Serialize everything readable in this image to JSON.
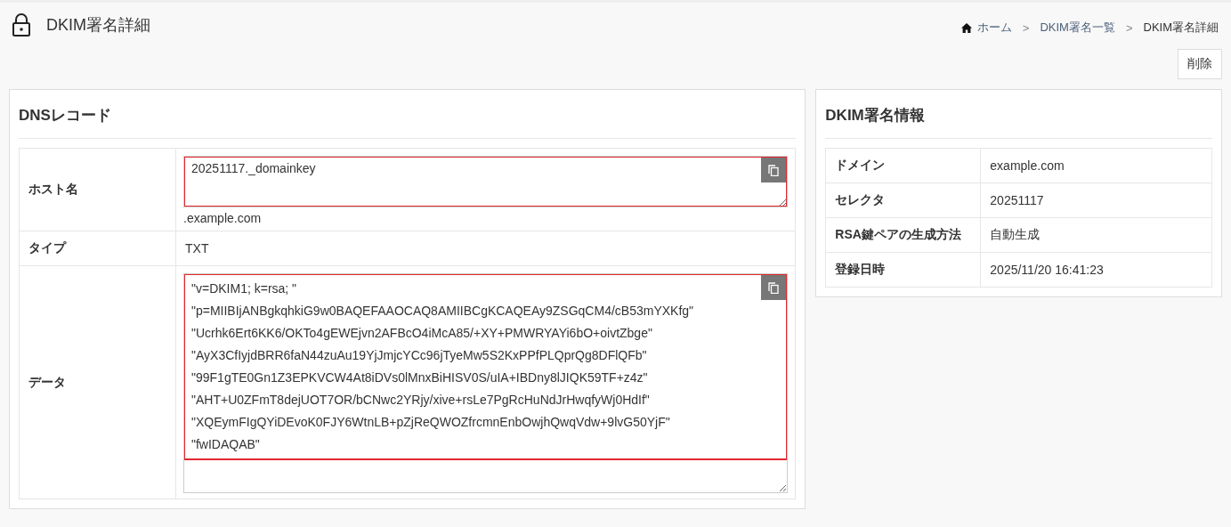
{
  "header": {
    "title": "DKIM署名詳細"
  },
  "breadcrumb": [
    {
      "label": "ホーム",
      "kind": "home"
    },
    {
      "label": ">",
      "kind": "separator"
    },
    {
      "label": "DKIM署名一覧",
      "kind": "link"
    },
    {
      "label": ">",
      "kind": "separator"
    },
    {
      "label": "DKIM署名詳細",
      "kind": "current"
    }
  ],
  "actions": [
    {
      "label": "削除"
    }
  ],
  "dns_record": {
    "title": "DNSレコード",
    "rows": [
      {
        "label": "ホスト名",
        "kind": "field",
        "field": {
          "lines": [
            "20251117._domainkey"
          ],
          "highlighted": true
        },
        "suffix": ".example.com"
      },
      {
        "label": "タイプ",
        "kind": "text",
        "value": "TXT"
      },
      {
        "label": "データ",
        "kind": "field",
        "field": {
          "lines": [
            "\"v=DKIM1; k=rsa; \"",
            "\"p=MIIBIjANBgkqhkiG9w0BAQEFAAOCAQ8AMIIBCgKCAQEAy9ZSGqCM4/cB53mYXKfg\"",
            "\"Ucrhk6Ert6KK6/OKTo4gEWEjvn2AFBcO4iMcA85/+XY+PMWRYAYi6bO+oivtZbge\"",
            "\"AyX3CfIyjdBRR6faN44zuAu19YjJmjcYCc96jTyeMw5S2KxPPfPLQprQg8DFlQFb\"",
            "\"99F1gTE0Gn1Z3EPKVCW4At8iDVs0lMnxBiHISV0S/uIA+IBDny8lJIQK59TF+z4z\"",
            "\"AHT+U0ZFmT8dejUOT7OR/bCNwc2YRjy/xive+rsLe7PgRcHuNdJrHwqfyWj0HdIf\"",
            "\"XQEymFIgQYiDEvoK0FJY6WtnLB+pZjReQWOZfrcmnEnbOwjhQwqVdw+9lvG50YjF\"",
            "\"fwIDAQAB\""
          ],
          "highlighted": true
        }
      }
    ]
  },
  "dkim_info": {
    "title": "DKIM署名情報",
    "rows": [
      {
        "label": "ドメイン",
        "value": "example.com"
      },
      {
        "label": "セレクタ",
        "value": "20251117"
      },
      {
        "label": "RSA鍵ペアの生成方法",
        "value": "自動生成"
      },
      {
        "label": "登録日時",
        "value": "2025/11/20 16:41:23"
      }
    ]
  }
}
